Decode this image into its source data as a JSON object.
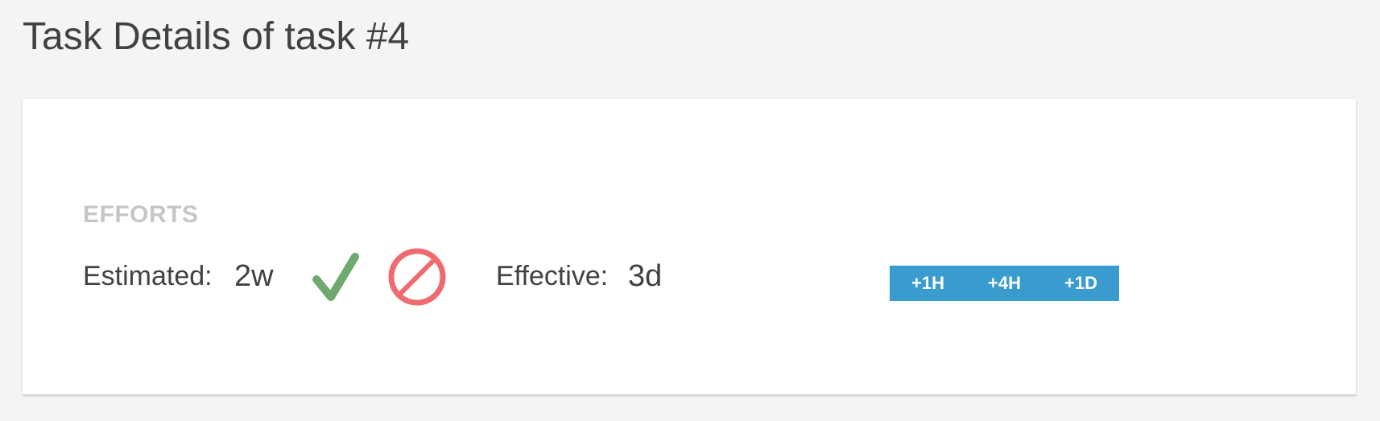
{
  "page": {
    "title": "Task Details of task #4"
  },
  "efforts": {
    "heading": "EFFORTS",
    "estimated_label": "Estimated:",
    "estimated_value": "2w",
    "confirm_icon": "checkmark-icon",
    "cancel_icon": "no-entry-icon",
    "effective_label": "Effective:",
    "effective_value": "3d",
    "quick_add": [
      "+1H",
      "+4H",
      "+1D"
    ]
  },
  "colors": {
    "background": "#f4f4f4",
    "card": "#ffffff",
    "title_text": "#3e4241",
    "heading_text": "#c6c6c6",
    "confirm_green": "#6ea96e",
    "cancel_red": "#f06b70",
    "button_blue": "#3a9bcf"
  }
}
